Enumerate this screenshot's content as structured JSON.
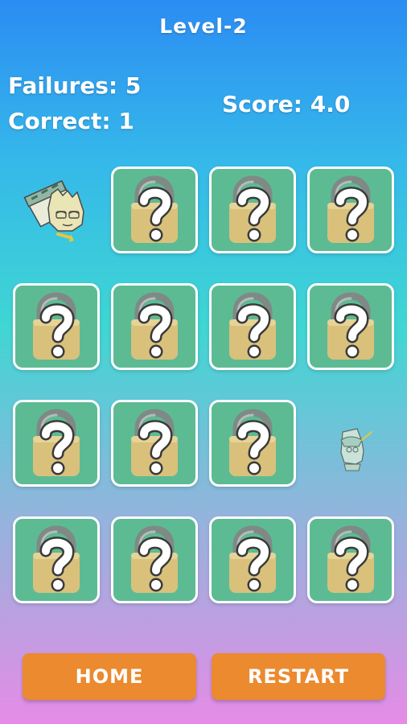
{
  "header": {
    "level": "Level-2",
    "failures": "Failures: 5",
    "correct": "Correct: 1",
    "score": "Score: 4.0"
  },
  "board": {
    "rows": [
      [
        "revealed-character",
        "hidden",
        "hidden",
        "hidden"
      ],
      [
        "hidden",
        "hidden",
        "hidden",
        "hidden"
      ],
      [
        "hidden",
        "hidden",
        "hidden",
        "revealed-character-small"
      ],
      [
        "hidden",
        "hidden",
        "hidden",
        "hidden"
      ]
    ],
    "hidden_card_icon": "padlock-question-icon",
    "card_color": "#5dbb94"
  },
  "buttons": {
    "home": "HOME",
    "restart": "RESTART"
  },
  "colors": {
    "button": "#eb8a2f",
    "lock_body": "#d9c17c"
  }
}
